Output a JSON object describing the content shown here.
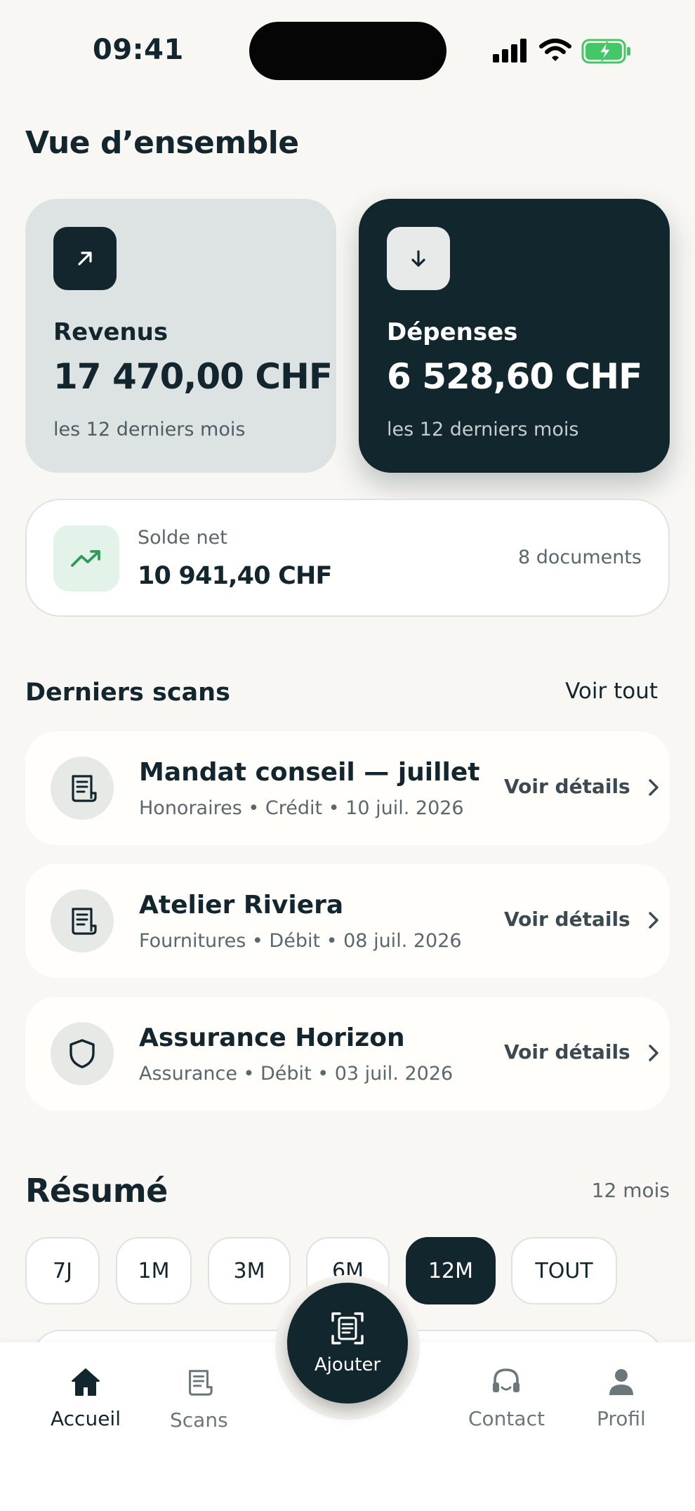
{
  "status_bar": {
    "time": "09:41"
  },
  "overview": {
    "title": "Vue d’ensemble",
    "revenue": {
      "label": "Revenus",
      "amount": "17 470,00 CHF",
      "period": "les 12 derniers mois",
      "icon": "arrow-up-right-icon"
    },
    "expenses": {
      "label": "Dépenses",
      "amount": "6 528,60 CHF",
      "period": "les 12 derniers mois",
      "icon": "arrow-down-icon"
    },
    "net": {
      "label": "Solde net",
      "amount": "10 941,40 CHF",
      "documents": "8 documents",
      "icon": "trending-up-icon"
    }
  },
  "recent_scans": {
    "title": "Derniers scans",
    "see_all": "Voir tout",
    "items": [
      {
        "name": "Mandat conseil — juillet",
        "meta": "Honoraires • Crédit • 10 juil. 2026",
        "details": "Voir détails",
        "icon": "receipt-icon"
      },
      {
        "name": "Atelier Riviera",
        "meta": "Fournitures • Débit • 08 juil. 2026",
        "details": "Voir détails",
        "icon": "receipt-icon"
      },
      {
        "name": "Assurance Horizon",
        "meta": "Assurance • Débit • 03 juil. 2026",
        "details": "Voir détails",
        "icon": "shield-icon"
      }
    ]
  },
  "summary": {
    "title": "Résumé",
    "period": "12 mois",
    "chips": [
      "7J",
      "1M",
      "3M",
      "6M",
      "12M",
      "TOUT"
    ],
    "active_chip": "12M"
  },
  "tabbar": {
    "home": "Accueil",
    "scans": "Scans",
    "add": "Ajouter",
    "contact": "Contact",
    "profile": "Profil"
  },
  "colors": {
    "dark": "#12262D",
    "light_card": "#DDE2E2",
    "accent_green": "#2E9B5B",
    "background": "#F8F7F4"
  }
}
